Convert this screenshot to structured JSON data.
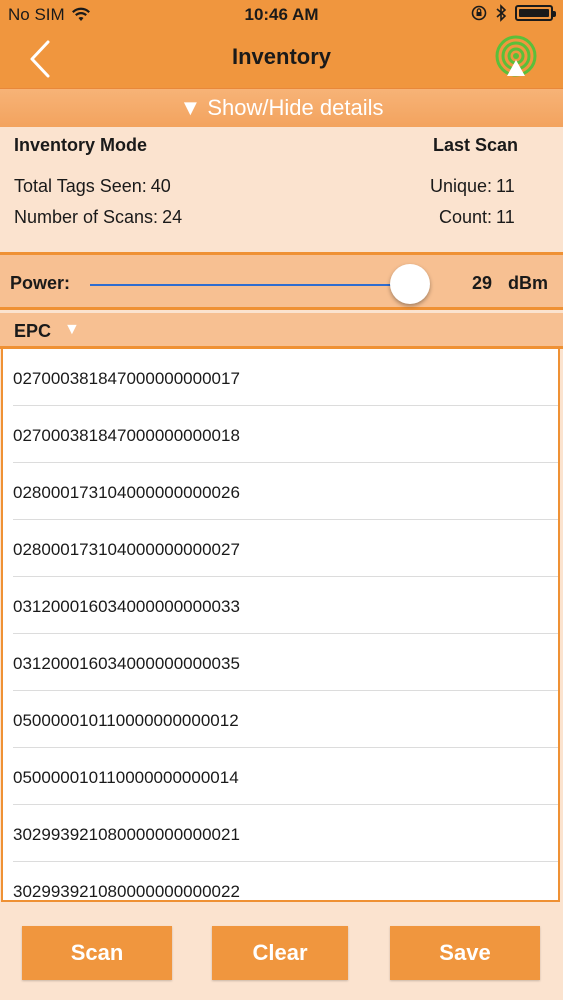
{
  "status_bar": {
    "carrier": "No SIM",
    "time": "10:46 AM"
  },
  "nav": {
    "title": "Inventory"
  },
  "toggle": {
    "label": "▼ Show/Hide details"
  },
  "details": {
    "mode_label": "Inventory Mode",
    "last_scan_label": "Last Scan",
    "total_tags_label": "Total Tags Seen:",
    "total_tags_value": "40",
    "scans_label": "Number of Scans:",
    "scans_value": "24",
    "unique_label": "Unique:",
    "unique_value": "11",
    "count_label": "Count:",
    "count_value": "11"
  },
  "power": {
    "label": "Power:",
    "value": "29",
    "unit": "dBm",
    "slider_fraction": 0.94
  },
  "epc": {
    "header": "EPC",
    "arrow": "▼",
    "items": [
      "027000381847000000000017",
      "027000381847000000000018",
      "028000173104000000000026",
      "028000173104000000000027",
      "031200016034000000000033",
      "031200016034000000000035",
      "050000010110000000000012",
      "050000010110000000000014",
      "302993921080000000000021",
      "302993921080000000000022"
    ]
  },
  "buttons": {
    "scan": "Scan",
    "clear": "Clear",
    "save": "Save"
  },
  "colors": {
    "orange": "#f0963e",
    "light_orange": "#fbe3cf",
    "slider_blue": "#2f6dd0",
    "signal_green": "#5bbf3a"
  }
}
